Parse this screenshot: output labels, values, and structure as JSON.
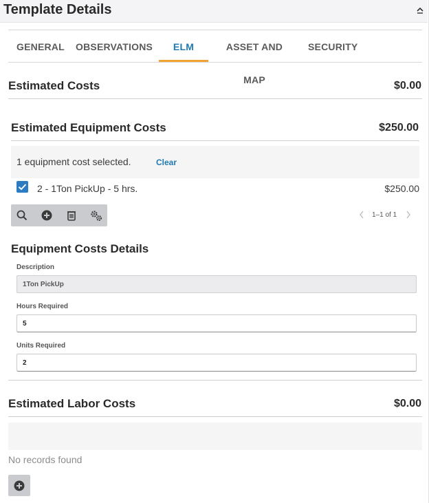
{
  "header": {
    "title": "Template Details",
    "collapse_icon": "chevron-up-icon"
  },
  "tabs": [
    {
      "label": "GENERAL",
      "active": false
    },
    {
      "label": "OBSERVATIONS",
      "active": false
    },
    {
      "label": "ELM",
      "active": true
    },
    {
      "label": "ASSET AND MAP",
      "active": false
    },
    {
      "label": "SECURITY",
      "active": false
    }
  ],
  "estimated_costs": {
    "title": "Estimated Costs",
    "amount": "$0.00"
  },
  "equipment": {
    "title": "Estimated Equipment Costs",
    "amount": "$250.00",
    "selection_text": "1 equipment cost selected.",
    "clear_label": "Clear",
    "rows": [
      {
        "label": "2 - 1Ton PickUp - 5 hrs.",
        "amount": "$250.00",
        "checked": true
      }
    ],
    "toolbar_icons": [
      "search-icon",
      "add-icon",
      "delete-icon",
      "settings-icon"
    ],
    "pager_text": "1–1 of 1"
  },
  "details": {
    "title": "Equipment Costs Details",
    "description_label": "Description",
    "description_value": "1Ton PickUp",
    "hours_label": "Hours Required",
    "hours_value": "5",
    "units_label": "Units Required",
    "units_value": "2"
  },
  "labor": {
    "title": "Estimated Labor Costs",
    "amount": "$0.00",
    "empty_text": "No records found"
  },
  "colors": {
    "accent": "#1f7ab0",
    "tab_underline": "#f0a330",
    "checkbox": "#2b7cc2"
  }
}
